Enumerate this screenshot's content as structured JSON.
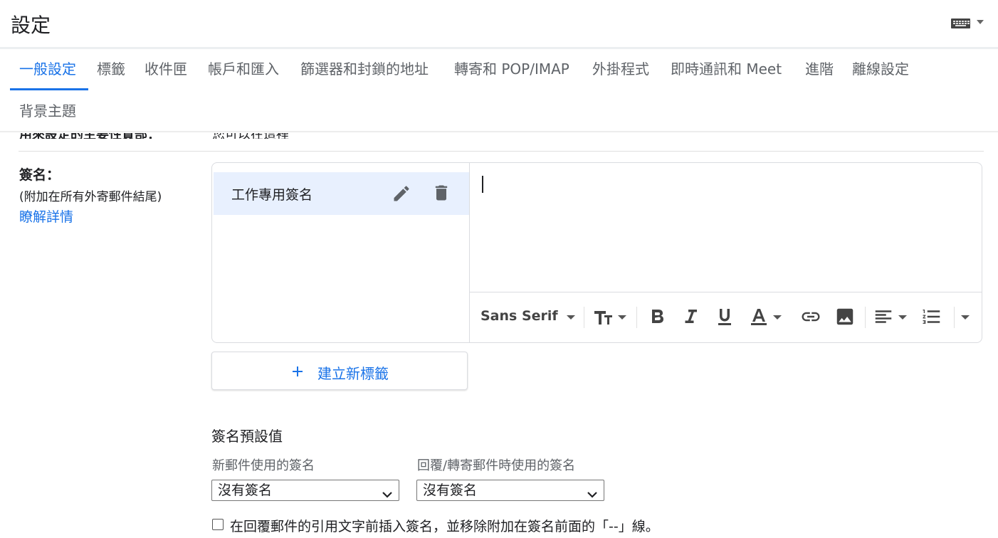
{
  "header": {
    "title": "設定"
  },
  "tabs": [
    {
      "label": "一般設定",
      "active": true
    },
    {
      "label": "標籤"
    },
    {
      "label": "收件匣"
    },
    {
      "label": "帳戶和匯入"
    },
    {
      "label": "篩選器和封鎖的地址"
    },
    {
      "label": "轉寄和 POP/IMAP"
    },
    {
      "label": "外掛程式"
    },
    {
      "label": "即時通訊和 Meet"
    },
    {
      "label": "進階"
    },
    {
      "label": "離線設定"
    },
    {
      "label": "背景主題"
    }
  ],
  "clipped_row": {
    "label": "用來設定的主要性質部：",
    "text": "您可以在這裡"
  },
  "signature": {
    "label": "簽名：",
    "sub": "(附加在所有外寄郵件結尾)",
    "learn_more": "瞭解詳情",
    "items": [
      {
        "name": "工作專用簽名"
      }
    ],
    "toolbar": {
      "font": "Sans Serif"
    },
    "create_button": "建立新標籤"
  },
  "defaults": {
    "title": "簽名預設值",
    "new_mail_label": "新郵件使用的簽名",
    "new_mail_value": "沒有簽名",
    "reply_label": "回覆/轉寄郵件時使用的簽名",
    "reply_value": "沒有簽名",
    "insert_before_quote": "在回覆郵件的引用文字前插入簽名，並移除附加在簽名前面的「--」線。"
  },
  "colors": {
    "accent": "#1a73e8",
    "selected_bg": "#e8f0fe"
  }
}
